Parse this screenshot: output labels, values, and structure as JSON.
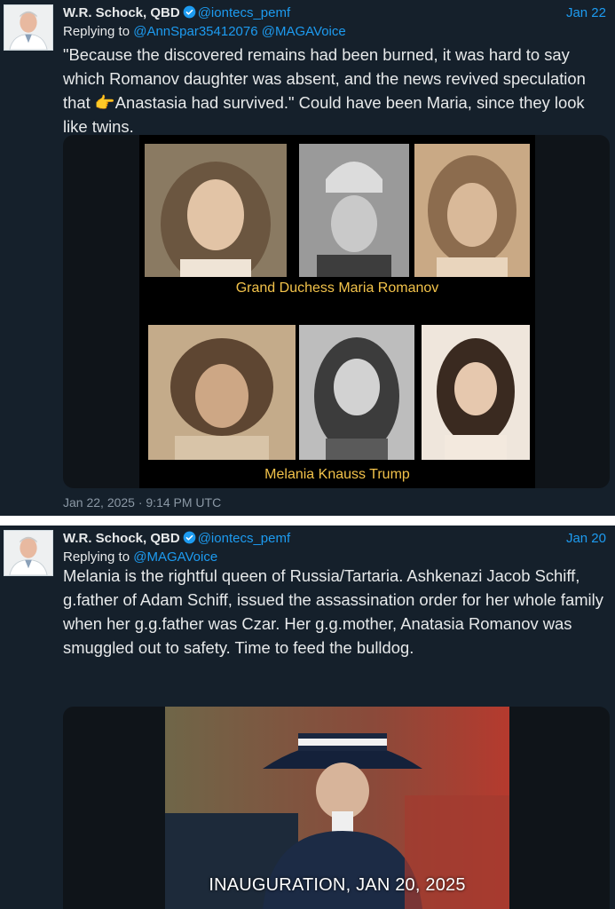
{
  "tweets": [
    {
      "author_name": "W.R. Schock, QBD",
      "handle": "@iontecs_pemf",
      "date": "Jan 22",
      "replying_prefix": "Replying to ",
      "replying_to": "@AnnSpar35412076 @MAGAVoice",
      "text_part1": "\"Because the discovered remains had been burned, it was hard to say which Romanov daughter was absent, and the news revived speculation that ",
      "emoji": "👉",
      "text_part2": "Anastasia had survived.\" Could have been Maria, since they look like twins.",
      "media": {
        "caption_top": "Grand Duchess Maria Romanov",
        "caption_bottom": "Melania Knauss Trump"
      },
      "timestamp": "Jan 22, 2025 · 9:14 PM UTC"
    },
    {
      "author_name": "W.R. Schock, QBD",
      "handle": "@iontecs_pemf",
      "date": "Jan 20",
      "replying_prefix": "Replying to ",
      "replying_to": "@MAGAVoice",
      "text": "Melania is the rightful queen of Russia/Tartaria. Ashkenazi Jacob Schiff, g.father of Adam Schiff, issued the assassination order for her whole family when her g.g.father was Czar. Her g.g.mother, Anatasia Romanov was smuggled out to safety. Time to feed the bulldog.",
      "media": {
        "overlay_text": "INAUGURATION, JAN 20, 2025"
      }
    }
  ],
  "colors": {
    "background": "#15202b",
    "link": "#1d9bf0",
    "text": "#e7e9ea",
    "muted": "#8b98a5",
    "caption": "#f2c24a"
  },
  "icons": [
    "verified-badge-icon",
    "avatar-photo"
  ]
}
